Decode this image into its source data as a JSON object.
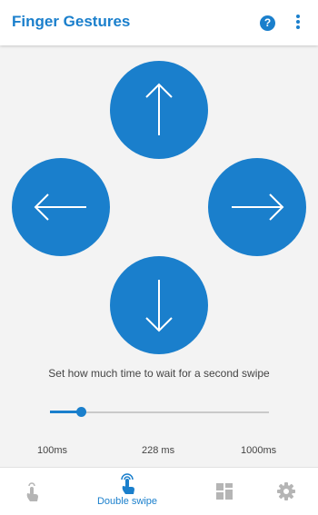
{
  "appbar": {
    "title": "Finger Gestures",
    "help_glyph": "?",
    "help_icon": "help-circle-icon",
    "overflow_icon": "more-vertical-icon"
  },
  "gestures": [
    {
      "direction": "up",
      "icon": "arrow-up-icon"
    },
    {
      "direction": "left",
      "icon": "arrow-left-icon"
    },
    {
      "direction": "right",
      "icon": "arrow-right-icon"
    },
    {
      "direction": "down",
      "icon": "arrow-down-icon"
    }
  ],
  "wait_setting": {
    "description": "Set how much time to wait for a second swipe",
    "min_label": "100ms",
    "current_label": "228 ms",
    "max_label": "1000ms",
    "min_value": 100,
    "max_value": 1000,
    "current_value": 228
  },
  "bottom_nav": {
    "items": [
      {
        "icon": "single-tap-icon",
        "label": "",
        "active": false
      },
      {
        "icon": "double-tap-icon",
        "label": "Double swipe",
        "active": true
      },
      {
        "icon": "grid-icon",
        "label": "",
        "active": false
      },
      {
        "icon": "gear-icon",
        "label": "",
        "active": false
      }
    ]
  },
  "colors": {
    "accent": "#1a7fcc",
    "inactive_icon": "#b5b5b5",
    "background": "#f3f3f3"
  }
}
